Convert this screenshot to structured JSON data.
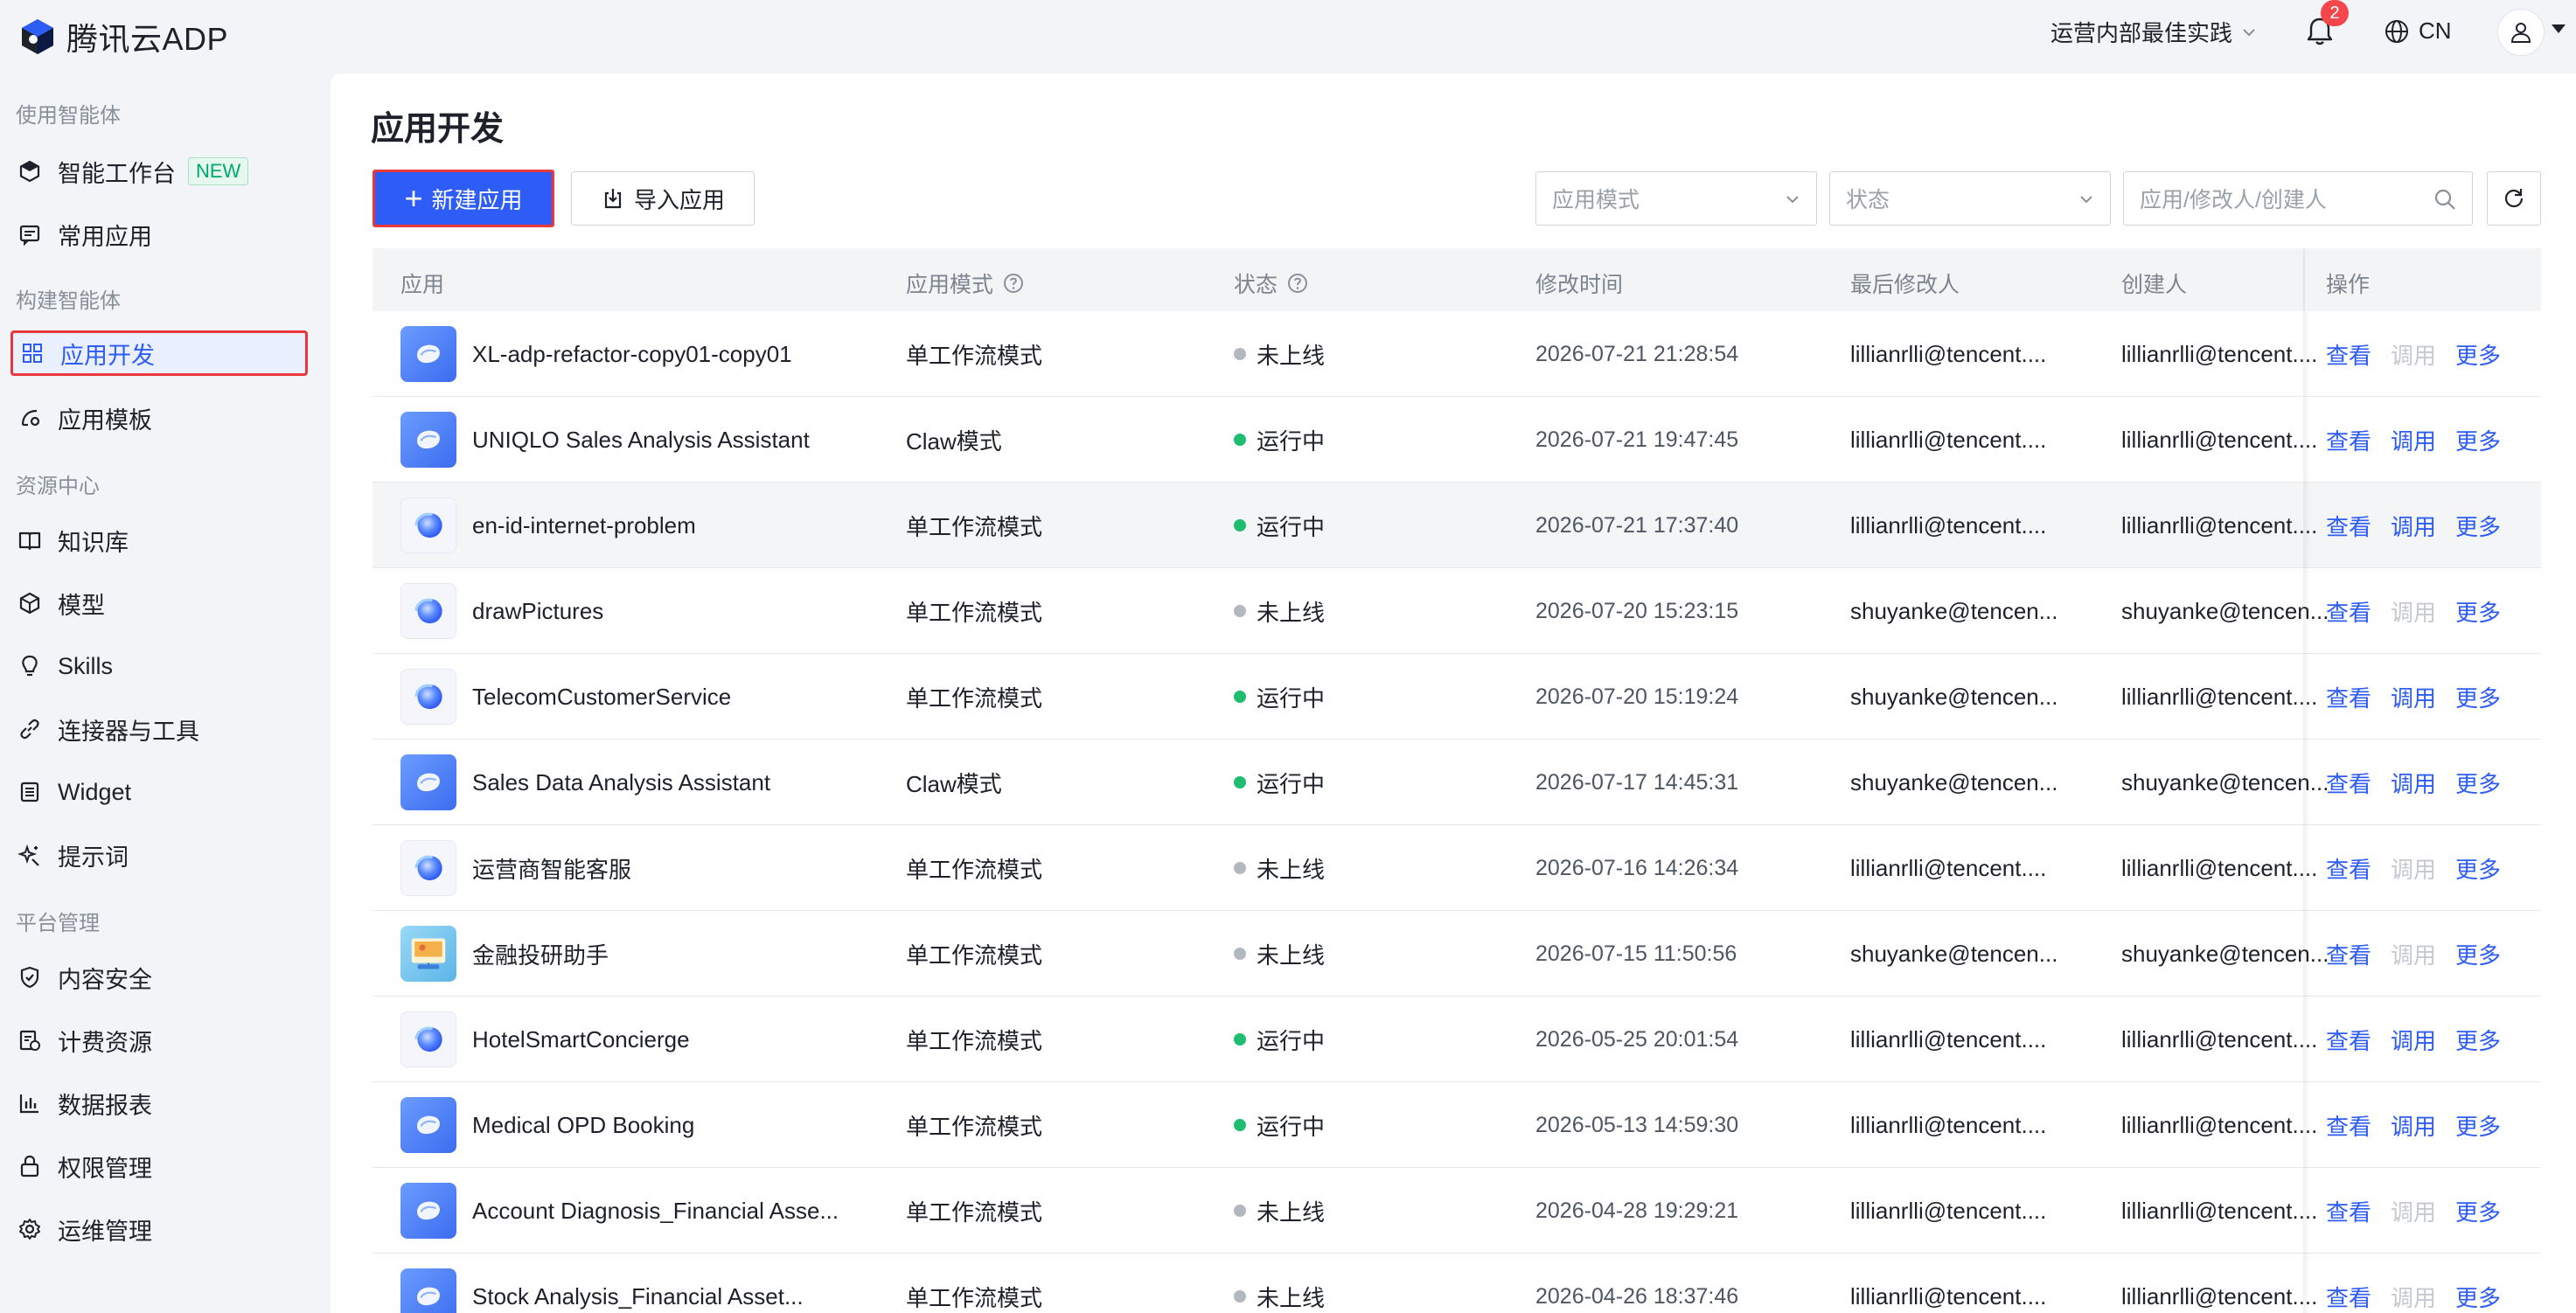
{
  "topbar": {
    "logo_text": "腾讯云ADP",
    "org_name": "运营内部最佳实践",
    "notification_count": "2",
    "language": "CN"
  },
  "sidebar": {
    "groups": [
      {
        "title": "使用智能体"
      },
      {
        "title": "构建智能体"
      },
      {
        "title": "资源中心"
      },
      {
        "title": "平台管理"
      }
    ],
    "items": [
      {
        "label": "智能工作台",
        "badge": "NEW",
        "icon": "cube-icon"
      },
      {
        "label": "常用应用",
        "icon": "message-icon"
      },
      {
        "label": "应用开发",
        "icon": "grid-icon",
        "active": true
      },
      {
        "label": "应用模板",
        "icon": "template-icon"
      },
      {
        "label": "知识库",
        "icon": "book-icon"
      },
      {
        "label": "模型",
        "icon": "model-icon"
      },
      {
        "label": "Skills",
        "icon": "bulb-icon"
      },
      {
        "label": "连接器与工具",
        "icon": "link-icon"
      },
      {
        "label": "Widget",
        "icon": "widget-icon"
      },
      {
        "label": "提示词",
        "icon": "sparkle-icon"
      },
      {
        "label": "内容安全",
        "icon": "shield-icon"
      },
      {
        "label": "计费资源",
        "icon": "billing-icon"
      },
      {
        "label": "数据报表",
        "icon": "chart-icon"
      },
      {
        "label": "权限管理",
        "icon": "lock-icon"
      },
      {
        "label": "运维管理",
        "icon": "gear-icon"
      }
    ]
  },
  "main": {
    "title": "应用开发",
    "new_button": "新建应用",
    "import_button": "导入应用",
    "mode_placeholder": "应用模式",
    "status_placeholder": "状态",
    "search_placeholder": "应用/修改人/创建人"
  },
  "table": {
    "headers": {
      "app": "应用",
      "mode": "应用模式",
      "status": "状态",
      "modified": "修改时间",
      "modified_by": "最后修改人",
      "creator": "创建人",
      "ops": "操作"
    },
    "ops_labels": {
      "view": "查看",
      "debug": "调用",
      "more": "更多"
    },
    "rows": [
      {
        "name": "XL-adp-refactor-copy01-copy01",
        "icon": "flow",
        "mode": "单工作流模式",
        "status": "未上线",
        "online": false,
        "time": "2026-07-21 21:28:54",
        "modified_by": "lillianrlli@tencent....",
        "creator": "lillianrlli@tencent...."
      },
      {
        "name": "UNIQLO Sales Analysis Assistant",
        "icon": "flow",
        "mode": "Claw模式",
        "status": "运行中",
        "online": true,
        "time": "2026-07-21 19:47:45",
        "modified_by": "lillianrlli@tencent....",
        "creator": "lillianrlli@tencent...."
      },
      {
        "name": "en-id-internet-problem",
        "icon": "orb",
        "mode": "单工作流模式",
        "status": "运行中",
        "online": true,
        "time": "2026-07-21 17:37:40",
        "modified_by": "lillianrlli@tencent....",
        "creator": "lillianrlli@tencent....",
        "highlight": true
      },
      {
        "name": "drawPictures",
        "icon": "orb",
        "mode": "单工作流模式",
        "status": "未上线",
        "online": false,
        "time": "2026-07-20 15:23:15",
        "modified_by": "shuyanke@tencen...",
        "creator": "shuyanke@tencen..."
      },
      {
        "name": "TelecomCustomerService",
        "icon": "orb",
        "mode": "单工作流模式",
        "status": "运行中",
        "online": true,
        "time": "2026-07-20 15:19:24",
        "modified_by": "shuyanke@tencen...",
        "creator": "lillianrlli@tencent...."
      },
      {
        "name": "Sales Data Analysis Assistant",
        "icon": "flow",
        "mode": "Claw模式",
        "status": "运行中",
        "online": true,
        "time": "2026-07-17 14:45:31",
        "modified_by": "shuyanke@tencen...",
        "creator": "shuyanke@tencen..."
      },
      {
        "name": "运营商智能客服",
        "icon": "orb",
        "mode": "单工作流模式",
        "status": "未上线",
        "online": false,
        "time": "2026-07-16 14:26:34",
        "modified_by": "lillianrlli@tencent....",
        "creator": "lillianrlli@tencent...."
      },
      {
        "name": "金融投研助手",
        "icon": "photo",
        "mode": "单工作流模式",
        "status": "未上线",
        "online": false,
        "time": "2026-07-15 11:50:56",
        "modified_by": "shuyanke@tencen...",
        "creator": "shuyanke@tencen..."
      },
      {
        "name": "HotelSmartConcierge",
        "icon": "orb",
        "mode": "单工作流模式",
        "status": "运行中",
        "online": true,
        "time": "2026-05-25 20:01:54",
        "modified_by": "lillianrlli@tencent....",
        "creator": "lillianrlli@tencent...."
      },
      {
        "name": "Medical OPD Booking",
        "icon": "flow",
        "mode": "单工作流模式",
        "status": "运行中",
        "online": true,
        "time": "2026-05-13 14:59:30",
        "modified_by": "lillianrlli@tencent....",
        "creator": "lillianrlli@tencent...."
      },
      {
        "name": "Account Diagnosis_Financial Asse...",
        "icon": "flow",
        "mode": "单工作流模式",
        "status": "未上线",
        "online": false,
        "time": "2026-04-28 19:29:21",
        "modified_by": "lillianrlli@tencent....",
        "creator": "lillianrlli@tencent...."
      },
      {
        "name": "Stock Analysis_Financial Asset...",
        "icon": "flow",
        "mode": "单工作流模式",
        "status": "未上线",
        "online": false,
        "time": "2026-04-26 18:37:46",
        "modified_by": "lillianrlli@tencent....",
        "creator": "lillianrlli@tencent...."
      }
    ]
  },
  "colors": {
    "primary": "#2e5cf6",
    "running": "#1fbd6f",
    "offline": "#b3b8c0",
    "highlight_border": "#e8383b"
  }
}
